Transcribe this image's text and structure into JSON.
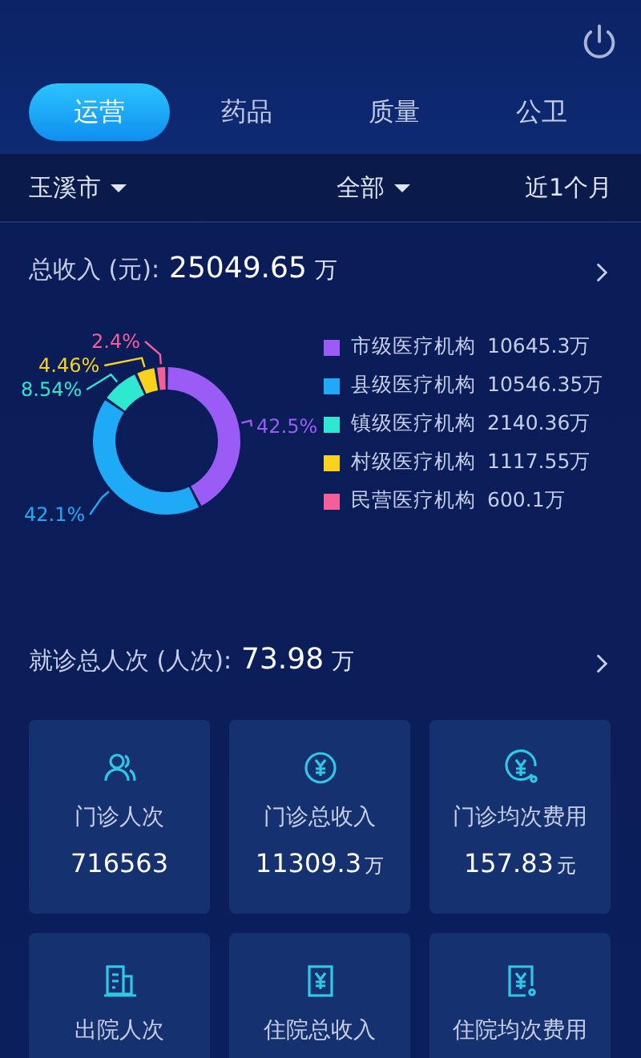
{
  "tabs": [
    {
      "label": "运营",
      "selected": true
    },
    {
      "label": "药品",
      "selected": false
    },
    {
      "label": "质量",
      "selected": false
    },
    {
      "label": "公卫",
      "selected": false
    }
  ],
  "filters": [
    {
      "label": "玉溪市",
      "dropdown": true
    },
    {
      "label": "全部",
      "dropdown": true
    },
    {
      "label": "近1个月",
      "dropdown": false
    }
  ],
  "income": {
    "label": "总收入 (元):",
    "value": "25049.65",
    "unit": "万",
    "chart_data": {
      "type": "donut",
      "categories": [
        "市级医疗机构",
        "县级医疗机构",
        "镇级医疗机构",
        "村级医疗机构",
        "民营医疗机构"
      ],
      "values": [
        42.5,
        42.1,
        8.54,
        4.46,
        2.4
      ],
      "value_labels": [
        "42.5%",
        "42.1%",
        "8.54%",
        "4.46%",
        "2.4%"
      ]
    },
    "legend": [
      {
        "amount": "10645.3万",
        "color": "#9b5cf6"
      },
      {
        "amount": "10546.35万",
        "color": "#1eaaf7"
      },
      {
        "amount": "2140.36万",
        "color": "#2ee8d0"
      },
      {
        "amount": "1117.55万",
        "color": "#f8d21c"
      },
      {
        "amount": "600.1万",
        "color": "#f45f9a"
      }
    ]
  },
  "visits": {
    "label": "就诊总人次 (人次):",
    "value": "73.98",
    "unit": "万",
    "cards": [
      {
        "label": "门诊人次",
        "value": "716563"
      },
      {
        "label": "门诊总收入",
        "value": "11309.3",
        "unit": "万"
      },
      {
        "label": "门诊均次费用",
        "value": "157.83",
        "unit": "元"
      },
      {
        "label": "出院人次"
      },
      {
        "label": "住院总收入"
      },
      {
        "label": "住院均次费用"
      }
    ]
  }
}
